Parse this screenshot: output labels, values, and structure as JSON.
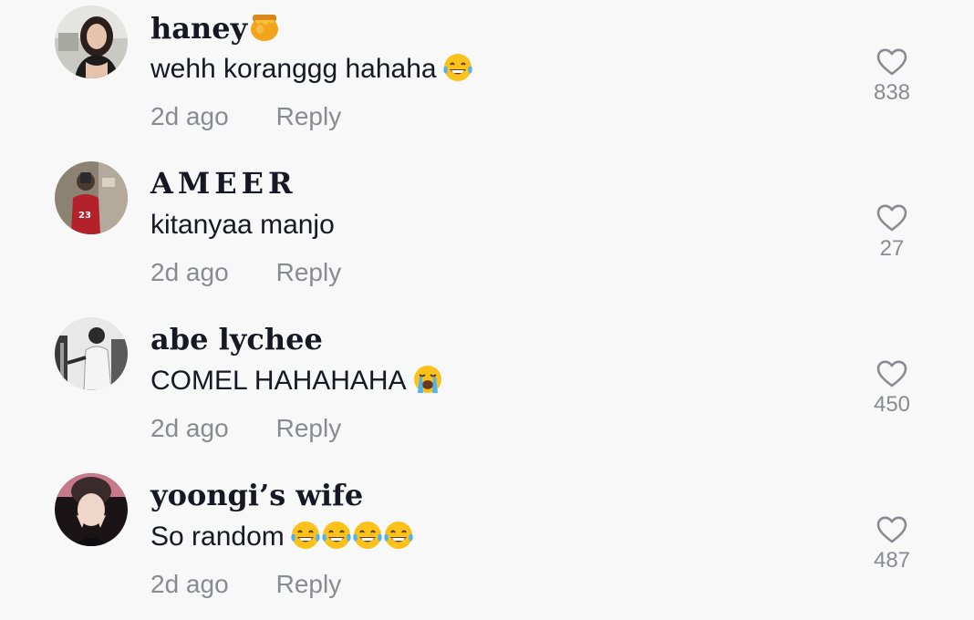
{
  "comments": [
    {
      "username": "haney",
      "username_emoji": "honey-pot",
      "text": "wehh koranggg hahaha",
      "text_emojis": [
        "face-with-tears-of-joy"
      ],
      "time": "2d ago",
      "reply_label": "Reply",
      "likes": "838"
    },
    {
      "username": "AMEER",
      "text": "kitanyaa manjo",
      "text_emojis": [],
      "time": "2d ago",
      "reply_label": "Reply",
      "likes": "27"
    },
    {
      "username": "abe lychee",
      "text": "COMEL HAHAHAHA",
      "text_emojis": [
        "loudly-crying-face"
      ],
      "time": "2d ago",
      "reply_label": "Reply",
      "likes": "450"
    },
    {
      "username": "yoongi’s wife",
      "text": "So random",
      "text_emojis": [
        "face-with-tears-of-joy",
        "face-with-tears-of-joy",
        "face-with-tears-of-joy",
        "face-with-tears-of-joy"
      ],
      "time": "2d ago",
      "reply_label": "Reply",
      "likes": "487"
    }
  ],
  "colors": {
    "background": "#f8f8f8",
    "primary_text": "#161823",
    "secondary_text": "#8a8b91",
    "like_icon": "#8a8b91"
  }
}
